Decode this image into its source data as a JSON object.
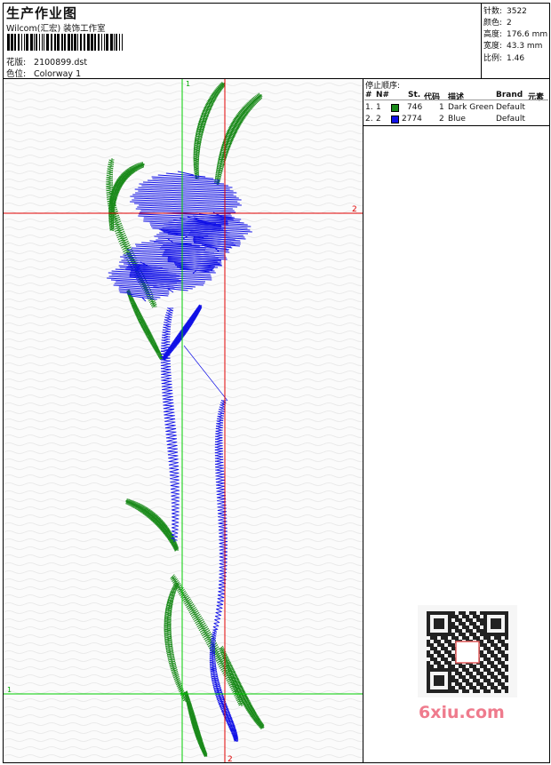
{
  "header": {
    "title": "生产作业图",
    "subtitle": "Wilcom(汇宏) 装饰工作室",
    "pattern_label": "花版:",
    "pattern_value": "2100899.dst",
    "colorway_label": "色位:",
    "colorway_value": "Colorway 1"
  },
  "stats": [
    {
      "label": "针数:",
      "value": "3522"
    },
    {
      "label": "颜色:",
      "value": "2"
    },
    {
      "label": "高度:",
      "value": "176.6 mm"
    },
    {
      "label": "宽度:",
      "value": "43.3 mm"
    },
    {
      "label": "比例:",
      "value": "1.46"
    }
  ],
  "stop_sequence": {
    "title": "停止顺序:",
    "columns": [
      "#",
      "N#",
      "St.",
      "代码",
      "描述",
      "Brand",
      "元素"
    ],
    "rows": [
      {
        "index": "1.",
        "n": "1",
        "stitches": "746",
        "code": "1",
        "description": "Dark Green",
        "brand": "Default",
        "color": "#1a8a1a"
      },
      {
        "index": "2.",
        "n": "2",
        "stitches": "2774",
        "code": "2",
        "description": "Blue",
        "brand": "Default",
        "color": "#1010e6"
      }
    ]
  },
  "guides": {
    "vertical_green": "1",
    "horizontal_red": "2",
    "vertical_red": "2",
    "horizontal_green": "1"
  },
  "colors": {
    "thread_green": "#1a8a1a",
    "thread_blue": "#1010e6",
    "guide_green": "#00cc00",
    "guide_red": "#e00000"
  },
  "watermark": "6xiu.com"
}
